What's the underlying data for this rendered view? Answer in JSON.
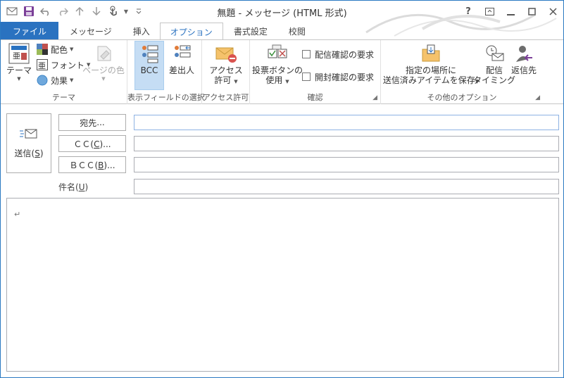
{
  "window": {
    "title": "無題 - メッセージ (HTML 形式)",
    "controls": {
      "help": "?",
      "restore_ribbon": "⧉",
      "minimize": "—",
      "maximize": "☐",
      "close": "✕"
    }
  },
  "tabs": [
    {
      "label": "ファイル"
    },
    {
      "label": "メッセージ"
    },
    {
      "label": "挿入"
    },
    {
      "label": "オプション"
    },
    {
      "label": "書式設定"
    },
    {
      "label": "校閲"
    }
  ],
  "ribbon": {
    "theme": {
      "theme_label": "テーマ",
      "colors_label": "配色",
      "fonts_label": "フォント",
      "effects_label": "効果",
      "page_color_label": "ページの色",
      "group_label": "テーマ"
    },
    "show_fields": {
      "bcc_label": "BCC",
      "from_label": "差出人",
      "group_label": "表示フィールドの選択"
    },
    "permission": {
      "access_label_1": "アクセス",
      "access_label_2": "許可",
      "group_label": "アクセス許可"
    },
    "tracking": {
      "voting_label_1": "投票ボタンの",
      "voting_label_2": "使用",
      "delivery_receipt": "配信確認の要求",
      "read_receipt": "開封確認の要求",
      "group_label": "確認"
    },
    "more_options": {
      "save_sent_label_1": "指定の場所に",
      "save_sent_label_2": "送信済みアイテムを保存",
      "delay_label_1": "配信",
      "delay_label_2": "タイミング",
      "reply_to_label": "返信先",
      "group_label": "その他のオプション"
    }
  },
  "form": {
    "send_label": "送信",
    "send_key": "S",
    "to_label": "宛先",
    "to_key": "...",
    "cc_label": "ＣＣ",
    "cc_key": "C",
    "bcc_label": "ＢＣＣ",
    "bcc_key": "B",
    "subject_label": "件名",
    "subject_key": "U",
    "to_value": "",
    "cc_value": "",
    "bcc_value": "",
    "subject_value": "",
    "body_marker": "↵"
  }
}
